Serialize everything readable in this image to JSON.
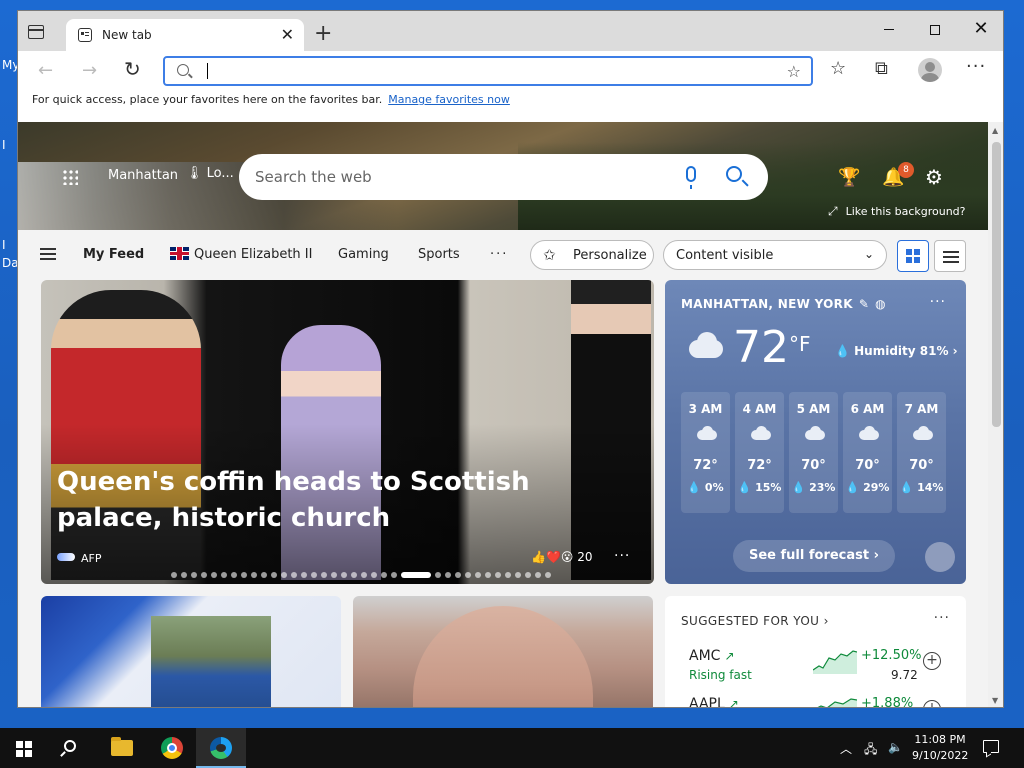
{
  "desktop": {
    "labels": [
      "My",
      "I",
      "I",
      "Da"
    ]
  },
  "browser": {
    "tab": {
      "title": "New tab",
      "close": "✕"
    },
    "new_tab": "+",
    "window": {
      "minimize": "",
      "maximize": "",
      "close": "✕"
    },
    "toolbar": {
      "back": "←",
      "forward": "→",
      "reload": "↻",
      "address_value": "",
      "more": "···"
    },
    "favbar": {
      "text": "For quick access, place your favorites here on the favorites bar.",
      "link": "Manage favorites now"
    }
  },
  "ntp": {
    "header": {
      "location": "Manhattan",
      "weather_short": "🌡 Lo...",
      "search_placeholder": "Search the web",
      "notifications_count": "8",
      "like_background": "Like this background?"
    },
    "nav": {
      "items": [
        "My Feed",
        "Queen Elizabeth II",
        "Gaming",
        "Sports"
      ],
      "more": "···",
      "personalize": "Personalize",
      "content_visible": "Content visible"
    },
    "hero_card": {
      "title": "Queen's coffin heads to Scottish palace, historic church",
      "source": "AFP",
      "reactions": "👍❤️😮",
      "reaction_count": "20",
      "more": "···",
      "slide_count": 36,
      "active_slide": 23
    },
    "weather": {
      "location": "MANHATTAN, NEW YORK",
      "temp": "72",
      "unit": "°F",
      "humidity": "💧 Humidity 81% ›",
      "hours": [
        {
          "time": "3 AM",
          "temp": "72°",
          "precip": "💧 0%"
        },
        {
          "time": "4 AM",
          "temp": "72°",
          "precip": "💧 15%"
        },
        {
          "time": "5 AM",
          "temp": "70°",
          "precip": "💧 23%"
        },
        {
          "time": "6 AM",
          "temp": "70°",
          "precip": "💧 29%"
        },
        {
          "time": "7 AM",
          "temp": "70°",
          "precip": "💧 14%"
        }
      ],
      "forecast_button": "See full forecast ›",
      "more": "···"
    },
    "suggested": {
      "title": "SUGGESTED FOR YOU ›",
      "more": "···",
      "stocks": [
        {
          "symbol": "AMC",
          "sub": "Rising fast",
          "change": "+12.50%",
          "price": "9.72"
        },
        {
          "symbol": "AAPL",
          "sub": "",
          "change": "+1.88%",
          "price": ""
        }
      ]
    }
  },
  "taskbar": {
    "time": "11:08 PM",
    "date": "9/10/2022"
  },
  "colors": {
    "accent": "#1a6fd6",
    "weather_card": "#5a74a6",
    "stock_up": "#0f8a3b"
  }
}
